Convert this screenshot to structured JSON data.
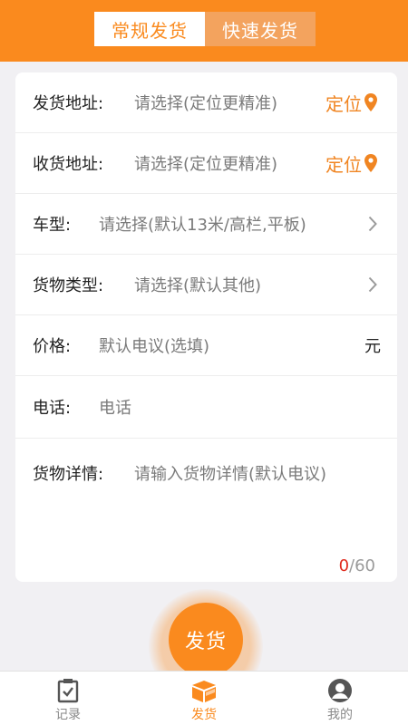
{
  "header": {
    "tabs": [
      {
        "label": "常规发货",
        "active": true
      },
      {
        "label": "快速发货",
        "active": false
      }
    ]
  },
  "form": {
    "send_address": {
      "label": "发货地址:",
      "placeholder": "请选择(定位更精准)",
      "action": "定位",
      "icon": "location-pin-icon"
    },
    "receive_address": {
      "label": "收货地址:",
      "placeholder": "请选择(定位更精准)",
      "action": "定位",
      "icon": "location-pin-icon"
    },
    "vehicle_type": {
      "label": "车型:",
      "placeholder": "请选择(默认13米/高栏,平板)",
      "icon": "chevron-right-icon"
    },
    "cargo_type": {
      "label": "货物类型:",
      "placeholder": "请选择(默认其他)",
      "icon": "chevron-right-icon"
    },
    "price": {
      "label": "价格:",
      "placeholder": "默认电议(选填)",
      "unit": "元"
    },
    "phone": {
      "label": "电话:",
      "placeholder": "电话"
    },
    "cargo_detail": {
      "label": "货物详情:",
      "placeholder": "请输入货物详情(默认电议)",
      "count": "0",
      "max": "/60"
    }
  },
  "submit_label": "发货",
  "bottom_nav": [
    {
      "label": "记录",
      "icon": "clipboard-icon",
      "active": false
    },
    {
      "label": "发货",
      "icon": "package-icon",
      "active": true
    },
    {
      "label": "我的",
      "icon": "user-avatar-icon",
      "active": false
    }
  ],
  "colors": {
    "accent": "#fa8a1e",
    "counter_current": "#e02a1d"
  }
}
